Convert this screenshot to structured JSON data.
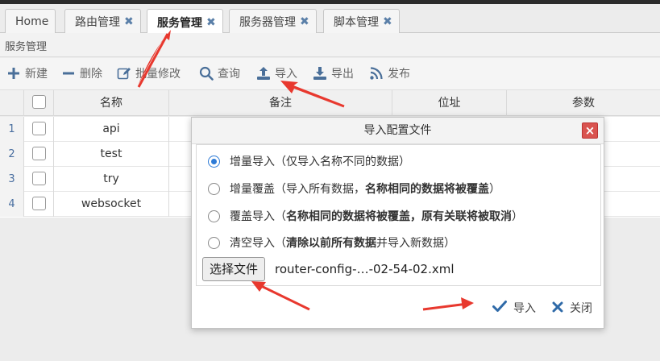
{
  "tabs": [
    {
      "label": "Home",
      "closable": false,
      "active": false
    },
    {
      "label": "路由管理",
      "closable": true,
      "active": false
    },
    {
      "label": "服务管理",
      "closable": true,
      "active": true
    },
    {
      "label": "服务器管理",
      "closable": true,
      "active": false
    },
    {
      "label": "脚本管理",
      "closable": true,
      "active": false
    }
  ],
  "close_glyph": "✖",
  "breadcrumb": "服务管理",
  "toolbar": {
    "new": "新建",
    "delete": "删除",
    "batch_edit": "批量修改",
    "query": "查询",
    "import": "导入",
    "export": "导出",
    "publish": "发布"
  },
  "grid": {
    "columns": [
      "名称",
      "备注",
      "位址",
      "参数"
    ],
    "rows": [
      {
        "num": "1",
        "name": "api"
      },
      {
        "num": "2",
        "name": "test"
      },
      {
        "num": "3",
        "name": "try"
      },
      {
        "num": "4",
        "name": "websocket"
      }
    ]
  },
  "dialog": {
    "title": "导入配置文件",
    "options": [
      {
        "label_a": "增量导入（仅导入名称不同的数据）",
        "label_b": "",
        "label_c": "",
        "checked": true
      },
      {
        "label_a": "增量覆盖（导入所有数据，",
        "label_b": "名称相同的数据将被覆盖",
        "label_c": "）",
        "checked": false
      },
      {
        "label_a": "覆盖导入（",
        "label_b": "名称相同的数据将被覆盖，原有关联将被取消",
        "label_c": "）",
        "checked": false
      },
      {
        "label_a": "清空导入（",
        "label_b": "清除以前所有数据",
        "label_c": "并导入新数据）",
        "checked": false
      }
    ],
    "file_button": "选择文件",
    "file_name": "router-config-…-02-54-02.xml",
    "ok_label": "导入",
    "cancel_label": "关闭"
  },
  "colors": {
    "accent": "#2d7ad6",
    "icon": "#4a6f99",
    "close": "#d9534f",
    "annotation": "#e8382e"
  }
}
